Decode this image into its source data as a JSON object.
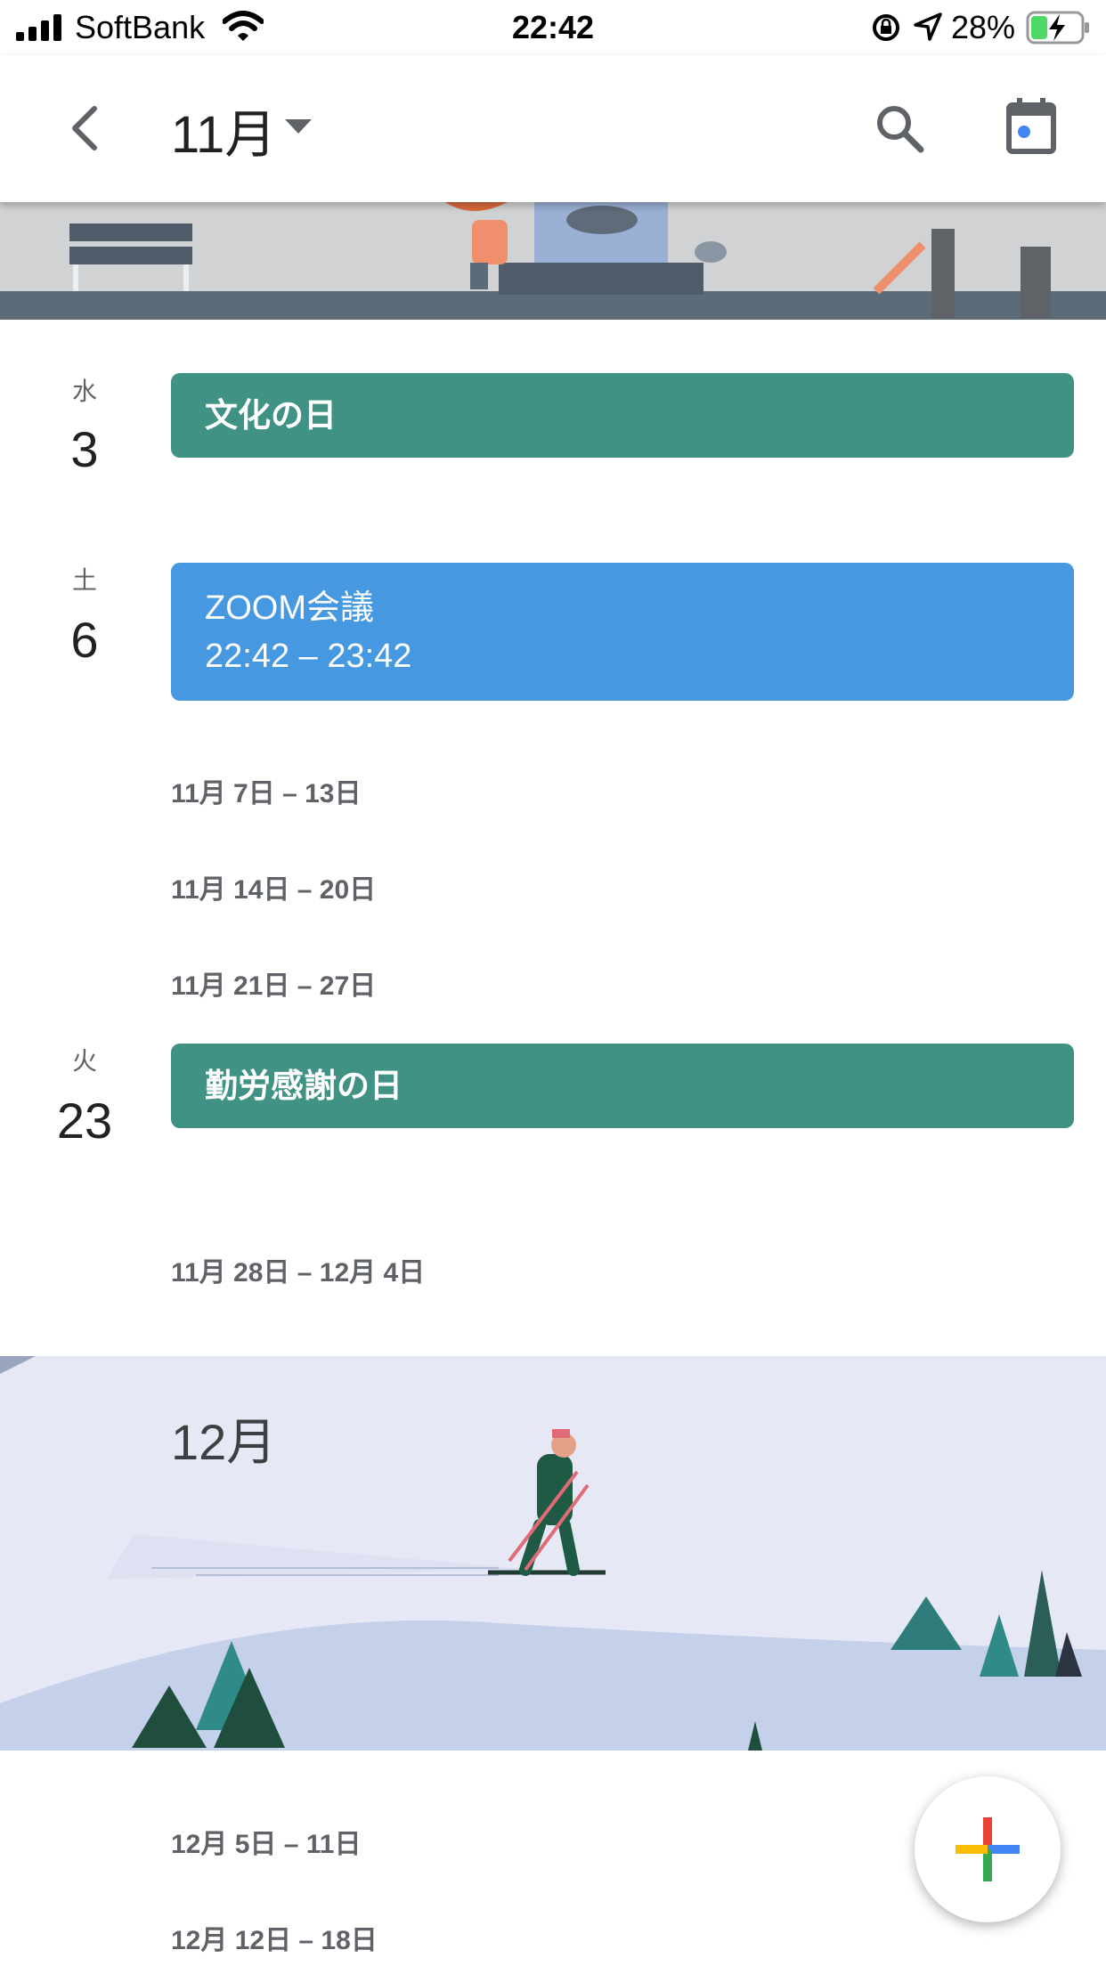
{
  "status_bar": {
    "carrier": "SoftBank",
    "time": "22:42",
    "battery_percent": "28%"
  },
  "header": {
    "month": "11月"
  },
  "events": [
    {
      "weekday": "水",
      "day": "3",
      "title": "文化の日",
      "type": "holiday",
      "color": "#409384"
    },
    {
      "weekday": "土",
      "day": "6",
      "title": "ZOOM会議",
      "time": "22:42 – 23:42",
      "type": "meeting",
      "color": "#4698e0"
    },
    {
      "weekday": "火",
      "day": "23",
      "title": "勤労感謝の日",
      "type": "holiday",
      "color": "#409384"
    }
  ],
  "weeks": [
    "11月 7日 – 13日",
    "11月 14日 – 20日",
    "11月 21日 – 27日",
    "11月 28日 – 12月 4日",
    "12月 5日 – 11日",
    "12月 12日 – 18日"
  ],
  "december_banner": {
    "title": "12月"
  },
  "icons": [
    "signal-icon",
    "wifi-icon",
    "lock-rotation-icon",
    "location-arrow-icon",
    "battery-charging-icon",
    "back-arrow-icon",
    "dropdown-arrow-icon",
    "search-icon",
    "today-calendar-icon",
    "add-icon"
  ]
}
